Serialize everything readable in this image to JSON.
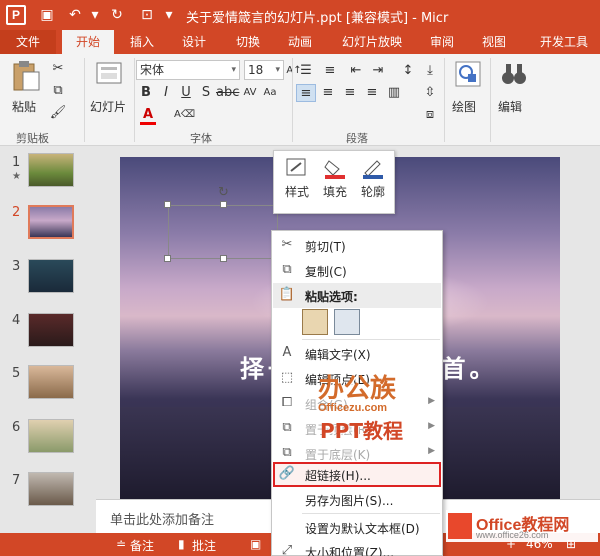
{
  "app": {
    "title": "关于爱情箴言的幻灯片.ppt [兼容模式] - Micr",
    "logo_letter": "P",
    "brand_color": "#d24726"
  },
  "tabs": [
    "文件",
    "开始",
    "插入",
    "设计",
    "切换",
    "动画",
    "幻灯片放映",
    "审阅",
    "视图",
    "开发工具"
  ],
  "active_tab": "开始",
  "ribbon": {
    "paste_label": "粘贴",
    "clipboard_group": "剪贴板",
    "slides_label": "幻灯片",
    "font_name": "宋体",
    "font_size": "18",
    "font_group": "字体",
    "paragraph_group": "段落",
    "drawing_label": "绘图",
    "editing_label": "编辑"
  },
  "slide_numbers": [
    "1",
    "2",
    "3",
    "4",
    "5",
    "6",
    "7"
  ],
  "active_slide": "2",
  "slide": {
    "text": "择一 ·· ·· 人白首。"
  },
  "notes_placeholder": "单击此处添加备注",
  "mini_toolbar": {
    "style": "样式",
    "fill": "填充",
    "outline": "轮廓"
  },
  "context_menu": {
    "cut": "剪切(T)",
    "copy": "复制(C)",
    "paste_options": "粘贴选项:",
    "edit_text": "编辑文字(X)",
    "edit_points": "编辑顶点(E)",
    "group": "组合(G)",
    "bring_front": "置于顶层(R)",
    "send_back": "置于底层(K)",
    "hyperlink": "超链接(H)...",
    "save_as_picture": "另存为图片(S)...",
    "set_default_textbox": "设置为默认文本框(D)",
    "size_position": "大小和位置(Z)..."
  },
  "status": {
    "notes": "备注",
    "comments": "批注",
    "zoom": "46%"
  },
  "watermarks": {
    "w1": "办公族",
    "w1_url": "Officezu.com",
    "w2": "PPT教程",
    "w3": "Office教程网",
    "w3_url": "www.office26.com"
  }
}
